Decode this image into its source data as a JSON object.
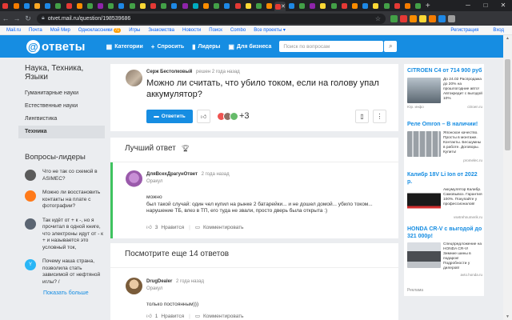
{
  "browser": {
    "tab_colors": [
      "#e53935",
      "#f57c00",
      "#1e88e5",
      "#f9a825",
      "#1e88e5",
      "#43a047",
      "#e53935",
      "#fb8c00",
      "#43a047",
      "#8e24aa",
      "#43a047",
      "#1e88e5",
      "#43a047",
      "#fdd835",
      "#e53935",
      "#43a047",
      "#1e88e5",
      "#8e24aa",
      "#00acc1",
      "#fb8c00",
      "#43a047",
      "#1e88e5",
      "#e53935",
      "#fdd835",
      "#43a047",
      "#fb8c00",
      "#e53935",
      "#1e88e5",
      "#43a047",
      "#8e24aa",
      "#fdd835",
      "#43a047",
      "#e53935",
      "#fb8c00",
      "#1e88e5",
      "#fdd835",
      "#43a047",
      "#e53935",
      "#f57c00",
      "#43a047"
    ],
    "active_tab_close": "✕",
    "new_tab": "+",
    "url": "otvet.mail.ru/question/198539686",
    "extension_colors": [
      "#43a047",
      "#e53935",
      "#fb8c00",
      "#fdd835",
      "#f57c00",
      "#1e88e5",
      "#9e9e9e"
    ]
  },
  "portal": {
    "links": [
      "Mail.ru",
      "Почта",
      "Мой Мир",
      "Одноклассники",
      "Игры",
      "Знакомства",
      "Новости",
      "Поиск",
      "Combo",
      "Все проекты ▾"
    ],
    "ok_badge": "71",
    "register": "Регистрация",
    "login": "Вход"
  },
  "header": {
    "logo": "ответы",
    "nav": {
      "categories": "Категории",
      "ask": "Спросить",
      "leaders": "Лидеры",
      "business": "Для бизнеса"
    },
    "search_placeholder": "Поиск по вопросам"
  },
  "sidebar": {
    "category_title": "Наука, Техника, Языки",
    "categories": [
      "Гуманитарные науки",
      "Естественные науки",
      "Лингвистика",
      "Техника"
    ],
    "leaders_title": "Вопросы-лидеры",
    "leaders": [
      {
        "text": "Что не так со схемой в ASIMEC?",
        "color": "#5b5b5b"
      },
      {
        "text": "Можно ли восстановить контакты на плате с фотографии?",
        "color": "#ff7a1a"
      },
      {
        "text": "Так идёт от + к -, но я прочитал в одной книге, что электроны идут от - к + и называется это условный ток,",
        "color": "#5b6572"
      },
      {
        "text": "Почему наша страна, позволила стать зависимой от нефтяной иглы? /",
        "color": "#29b6f6"
      }
    ],
    "leaders_avatar_letter": "Y",
    "more_link": "Показать больше"
  },
  "question": {
    "author": "Серж Бестолковый",
    "info": "решен 2 года назад",
    "title": "Можно ли считать, что убило током, если на голову упал аккумулятор?",
    "answer_button": "Ответить",
    "vote_count": "+3",
    "vote_avatar_colors": [
      "#ef5350",
      "#8d6e63",
      "#66bb6a"
    ]
  },
  "best_answer": {
    "heading": "Лучший ответ",
    "author": "ДляВсехДрагунОтвет",
    "info": "2 года назад",
    "rank": "Оракул",
    "text": "можно\nбыл такой случай: один чел купил на рынке 2 батарейки... и не дошел домой... убило током...\nнарушение ТБ, влез в ТП, его туда не звали, просто дверь была открыта :)",
    "likes": "3",
    "like_label": "Нравится",
    "comment_label": "Комментировать"
  },
  "more_answers": {
    "heading": "Посмотрите еще 14 ответов",
    "author": "DrugDealer",
    "info": "2 года назад",
    "rank": "Оракул",
    "text": "только постоянным)))",
    "likes": "1",
    "like_label": "Нравится",
    "comment_label": "Комментировать"
  },
  "ads": {
    "items": [
      {
        "title": "CITROEN C4 от 714 900 руб",
        "text": "До 24.02 Распродажа до 20% на прошлогодние авто! Автокредит с выгодой 10%",
        "left": "Юр. инфо",
        "right": "citroen.ru",
        "img_color": "#7c8a96"
      },
      {
        "title": "Реле Omron – В наличии!",
        "text": "Японское качество. Просты в монтаже. Контакты. Бесшумны в работе. Договоры. Купить!",
        "left": "",
        "right": "promelec.ru",
        "img_color": "#8f949a"
      },
      {
        "title": "Калибр 18V Li Ion от 2022 р.",
        "text": "Аккумулятор Калибр. Самовывоз. Гарантия 100%. Покупайте у профессионалов!",
        "left": "",
        "right": "vsetrehnumerik.ru",
        "img_color": "#2e2e2e"
      },
      {
        "title": "HONDA CR-V с выгодой до 321 000р!",
        "text": "Спецпредложение на HONDA CR-V! Зимние шины в подарок! Подробности у дилеров!",
        "left": "",
        "right": "avto.honda.ru",
        "img_color": "#5d6066"
      }
    ],
    "label": "Реклама"
  }
}
